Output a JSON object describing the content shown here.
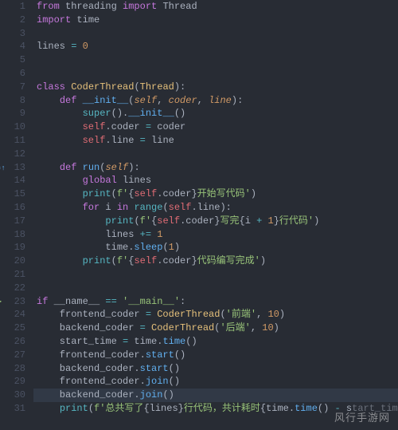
{
  "lines": [
    {
      "num": "1",
      "tokens": [
        [
          "kw",
          "from"
        ],
        [
          "plain",
          " threading "
        ],
        [
          "kw",
          "import"
        ],
        [
          "plain",
          " Thread"
        ]
      ]
    },
    {
      "num": "2",
      "tokens": [
        [
          "kw",
          "import"
        ],
        [
          "plain",
          " time"
        ]
      ]
    },
    {
      "num": "3",
      "tokens": []
    },
    {
      "num": "4",
      "tokens": [
        [
          "plain",
          "lines "
        ],
        [
          "op",
          "="
        ],
        [
          "plain",
          " "
        ],
        [
          "num",
          "0"
        ]
      ]
    },
    {
      "num": "5",
      "tokens": []
    },
    {
      "num": "6",
      "tokens": []
    },
    {
      "num": "7",
      "tokens": [
        [
          "kw",
          "class"
        ],
        [
          "plain",
          " "
        ],
        [
          "cls",
          "CoderThread"
        ],
        [
          "punct",
          "("
        ],
        [
          "cls",
          "Thread"
        ],
        [
          "punct",
          "):"
        ]
      ]
    },
    {
      "num": "8",
      "tokens": [
        [
          "plain",
          "    "
        ],
        [
          "kw",
          "def"
        ],
        [
          "plain",
          " "
        ],
        [
          "fn",
          "__init__"
        ],
        [
          "punct",
          "("
        ],
        [
          "param",
          "self"
        ],
        [
          "punct",
          ", "
        ],
        [
          "param",
          "coder"
        ],
        [
          "punct",
          ", "
        ],
        [
          "param",
          "line"
        ],
        [
          "punct",
          "):"
        ]
      ]
    },
    {
      "num": "9",
      "tokens": [
        [
          "plain",
          "        "
        ],
        [
          "builtin",
          "super"
        ],
        [
          "punct",
          "()."
        ],
        [
          "fn",
          "__init__"
        ],
        [
          "punct",
          "()"
        ]
      ]
    },
    {
      "num": "10",
      "tokens": [
        [
          "plain",
          "        "
        ],
        [
          "self",
          "self"
        ],
        [
          "punct",
          "."
        ],
        [
          "plain",
          "coder "
        ],
        [
          "op",
          "="
        ],
        [
          "plain",
          " coder"
        ]
      ]
    },
    {
      "num": "11",
      "tokens": [
        [
          "plain",
          "        "
        ],
        [
          "self",
          "self"
        ],
        [
          "punct",
          "."
        ],
        [
          "plain",
          "line "
        ],
        [
          "op",
          "="
        ],
        [
          "plain",
          " line"
        ]
      ]
    },
    {
      "num": "12",
      "tokens": []
    },
    {
      "num": "13",
      "gutter_icon": "modified",
      "tokens": [
        [
          "plain",
          "    "
        ],
        [
          "kw",
          "def"
        ],
        [
          "plain",
          " "
        ],
        [
          "fn",
          "run"
        ],
        [
          "punct",
          "("
        ],
        [
          "param",
          "self"
        ],
        [
          "punct",
          "):"
        ]
      ]
    },
    {
      "num": "14",
      "tokens": [
        [
          "plain",
          "        "
        ],
        [
          "kw",
          "global"
        ],
        [
          "plain",
          " lines"
        ]
      ]
    },
    {
      "num": "15",
      "tokens": [
        [
          "plain",
          "        "
        ],
        [
          "builtin",
          "print"
        ],
        [
          "punct",
          "("
        ],
        [
          "str",
          "f'"
        ],
        [
          "punct",
          "{"
        ],
        [
          "self",
          "self"
        ],
        [
          "punct",
          "."
        ],
        [
          "plain",
          "coder"
        ],
        [
          "punct",
          "}"
        ],
        [
          "str",
          "开始写代码'"
        ],
        [
          "punct",
          ")"
        ]
      ]
    },
    {
      "num": "16",
      "tokens": [
        [
          "plain",
          "        "
        ],
        [
          "kw",
          "for"
        ],
        [
          "plain",
          " i "
        ],
        [
          "kw",
          "in"
        ],
        [
          "plain",
          " "
        ],
        [
          "builtin",
          "range"
        ],
        [
          "punct",
          "("
        ],
        [
          "self",
          "self"
        ],
        [
          "punct",
          "."
        ],
        [
          "plain",
          "line"
        ],
        [
          "punct",
          "):"
        ]
      ]
    },
    {
      "num": "17",
      "tokens": [
        [
          "plain",
          "            "
        ],
        [
          "builtin",
          "print"
        ],
        [
          "punct",
          "("
        ],
        [
          "str",
          "f'"
        ],
        [
          "punct",
          "{"
        ],
        [
          "self",
          "self"
        ],
        [
          "punct",
          "."
        ],
        [
          "plain",
          "coder"
        ],
        [
          "punct",
          "}"
        ],
        [
          "str",
          "写完"
        ],
        [
          "punct",
          "{"
        ],
        [
          "plain",
          "i "
        ],
        [
          "op",
          "+"
        ],
        [
          "plain",
          " "
        ],
        [
          "num",
          "1"
        ],
        [
          "punct",
          "}"
        ],
        [
          "str",
          "行代码'"
        ],
        [
          "punct",
          ")"
        ]
      ]
    },
    {
      "num": "18",
      "tokens": [
        [
          "plain",
          "            lines "
        ],
        [
          "op",
          "+="
        ],
        [
          "plain",
          " "
        ],
        [
          "num",
          "1"
        ]
      ]
    },
    {
      "num": "19",
      "tokens": [
        [
          "plain",
          "            time."
        ],
        [
          "fn",
          "sleep"
        ],
        [
          "punct",
          "("
        ],
        [
          "num",
          "1"
        ],
        [
          "punct",
          ")"
        ]
      ]
    },
    {
      "num": "20",
      "tokens": [
        [
          "plain",
          "        "
        ],
        [
          "builtin",
          "print"
        ],
        [
          "punct",
          "("
        ],
        [
          "str",
          "f'"
        ],
        [
          "punct",
          "{"
        ],
        [
          "self",
          "self"
        ],
        [
          "punct",
          "."
        ],
        [
          "plain",
          "coder"
        ],
        [
          "punct",
          "}"
        ],
        [
          "str",
          "代码编写完成'"
        ],
        [
          "punct",
          ")"
        ]
      ]
    },
    {
      "num": "21",
      "tokens": []
    },
    {
      "num": "22",
      "tokens": []
    },
    {
      "num": "23",
      "gutter_icon": "run",
      "tokens": [
        [
          "kw",
          "if"
        ],
        [
          "plain",
          " __name__ "
        ],
        [
          "op",
          "=="
        ],
        [
          "plain",
          " "
        ],
        [
          "str",
          "'__main__'"
        ],
        [
          "punct",
          ":"
        ]
      ]
    },
    {
      "num": "24",
      "tokens": [
        [
          "plain",
          "    frontend_coder "
        ],
        [
          "op",
          "="
        ],
        [
          "plain",
          " "
        ],
        [
          "cls",
          "CoderThread"
        ],
        [
          "punct",
          "("
        ],
        [
          "str",
          "'前端'"
        ],
        [
          "punct",
          ", "
        ],
        [
          "num",
          "10"
        ],
        [
          "punct",
          ")"
        ]
      ]
    },
    {
      "num": "25",
      "tokens": [
        [
          "plain",
          "    backend_coder "
        ],
        [
          "op",
          "="
        ],
        [
          "plain",
          " "
        ],
        [
          "cls",
          "CoderThread"
        ],
        [
          "punct",
          "("
        ],
        [
          "str",
          "'后端'"
        ],
        [
          "punct",
          ", "
        ],
        [
          "num",
          "10"
        ],
        [
          "punct",
          ")"
        ]
      ]
    },
    {
      "num": "26",
      "tokens": [
        [
          "plain",
          "    start_time "
        ],
        [
          "op",
          "="
        ],
        [
          "plain",
          " time."
        ],
        [
          "fn",
          "time"
        ],
        [
          "punct",
          "()"
        ]
      ]
    },
    {
      "num": "27",
      "tokens": [
        [
          "plain",
          "    frontend_coder."
        ],
        [
          "fn",
          "start"
        ],
        [
          "punct",
          "()"
        ]
      ]
    },
    {
      "num": "28",
      "tokens": [
        [
          "plain",
          "    backend_coder."
        ],
        [
          "fn",
          "start"
        ],
        [
          "punct",
          "()"
        ]
      ]
    },
    {
      "num": "29",
      "tokens": [
        [
          "plain",
          "    frontend_coder."
        ],
        [
          "fn",
          "join"
        ],
        [
          "punct",
          "()"
        ]
      ]
    },
    {
      "num": "30",
      "highlighted": true,
      "tokens": [
        [
          "plain",
          "    backend_coder."
        ],
        [
          "fn",
          "join"
        ],
        [
          "punct",
          "()"
        ]
      ]
    },
    {
      "num": "31",
      "tokens": [
        [
          "plain",
          "    "
        ],
        [
          "builtin",
          "print"
        ],
        [
          "punct",
          "("
        ],
        [
          "str",
          "f'总共写了"
        ],
        [
          "punct",
          "{"
        ],
        [
          "plain",
          "lines"
        ],
        [
          "punct",
          "}"
        ],
        [
          "str",
          "行代码，共计耗时"
        ],
        [
          "punct",
          "{"
        ],
        [
          "plain",
          "time."
        ],
        [
          "fn",
          "time"
        ],
        [
          "punct",
          "() "
        ],
        [
          "op",
          "-"
        ],
        [
          "plain",
          " s"
        ],
        [
          "strdim",
          "tart_time}')"
        ]
      ]
    }
  ],
  "watermark": "风行手游网",
  "icons": {
    "modified": "◌↑",
    "run": "▶"
  }
}
